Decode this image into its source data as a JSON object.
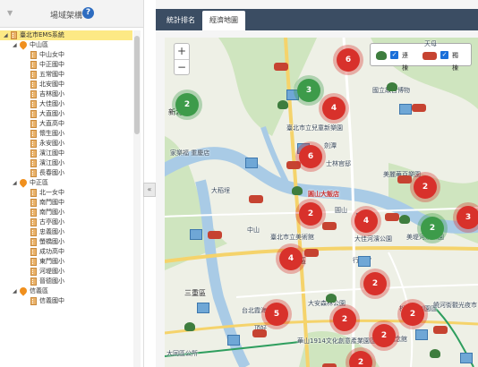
{
  "left": {
    "toggle_icon": "▼",
    "title": "場域架構",
    "help_icon": "?",
    "tree": [
      {
        "label": "臺北市EMS系統",
        "level": 0,
        "type": "root"
      },
      {
        "label": "中山區",
        "level": 1,
        "type": "district"
      },
      {
        "label": "中山女中",
        "level": 2,
        "type": "school"
      },
      {
        "label": "中正國中",
        "level": 2,
        "type": "school"
      },
      {
        "label": "五常國中",
        "level": 2,
        "type": "school"
      },
      {
        "label": "北安國中",
        "level": 2,
        "type": "school"
      },
      {
        "label": "吉林國小",
        "level": 2,
        "type": "school"
      },
      {
        "label": "大佳國小",
        "level": 2,
        "type": "school"
      },
      {
        "label": "大直國小",
        "level": 2,
        "type": "school"
      },
      {
        "label": "大直高中",
        "level": 2,
        "type": "school"
      },
      {
        "label": "懷生國小",
        "level": 2,
        "type": "school"
      },
      {
        "label": "永安國小",
        "level": 2,
        "type": "school"
      },
      {
        "label": "濱江國中",
        "level": 2,
        "type": "school"
      },
      {
        "label": "濱江國小",
        "level": 2,
        "type": "school"
      },
      {
        "label": "長春國小",
        "level": 2,
        "type": "school"
      },
      {
        "label": "中正區",
        "level": 1,
        "type": "district"
      },
      {
        "label": "北一女中",
        "level": 2,
        "type": "school"
      },
      {
        "label": "南門國中",
        "level": 2,
        "type": "school"
      },
      {
        "label": "南門國小",
        "level": 2,
        "type": "school"
      },
      {
        "label": "古亭國小",
        "level": 2,
        "type": "school"
      },
      {
        "label": "忠義國小",
        "level": 2,
        "type": "school"
      },
      {
        "label": "螢橋國小",
        "level": 2,
        "type": "school"
      },
      {
        "label": "成功高中",
        "level": 2,
        "type": "school"
      },
      {
        "label": "東門國小",
        "level": 2,
        "type": "school"
      },
      {
        "label": "河堤國小",
        "level": 2,
        "type": "school"
      },
      {
        "label": "晉德國小",
        "level": 2,
        "type": "school"
      },
      {
        "label": "信義區",
        "level": 1,
        "type": "district"
      },
      {
        "label": "信義國中",
        "level": 2,
        "type": "school"
      }
    ],
    "collapse_icon": "«"
  },
  "tabs": [
    {
      "label": "統計排名",
      "active": false
    },
    {
      "label": "經濟地圖",
      "active": true
    }
  ],
  "map": {
    "zoom_in": "+",
    "zoom_out": "−",
    "legend": [
      {
        "label": "連棟",
        "checked": true,
        "icon": "tree-icon"
      },
      {
        "label": "獨棟",
        "checked": true,
        "icon": "fire-truck-icon"
      }
    ],
    "clusters": [
      {
        "count": "6",
        "color": "red"
      },
      {
        "count": "2",
        "color": "green"
      },
      {
        "count": "3",
        "color": "green"
      },
      {
        "count": "4",
        "color": "red"
      },
      {
        "count": "6",
        "color": "red"
      },
      {
        "count": "2",
        "color": "red"
      },
      {
        "count": "4",
        "color": "red"
      },
      {
        "count": "2",
        "color": "green"
      },
      {
        "count": "3",
        "color": "red"
      },
      {
        "count": "2",
        "color": "red"
      },
      {
        "count": "4",
        "color": "red"
      },
      {
        "count": "2",
        "color": "red"
      },
      {
        "count": "5",
        "color": "red"
      },
      {
        "count": "2",
        "color": "red"
      },
      {
        "count": "2",
        "color": "red"
      },
      {
        "count": "2",
        "color": "red"
      },
      {
        "count": "2",
        "color": "red"
      }
    ],
    "places": [
      "新北市",
      "國立故宮博物",
      "臺北市立兒童新樂園",
      "士林官邸",
      "圓山大飯店",
      "家樂福 重慶店",
      "美麗華百樂園",
      "大稻埕",
      "臺北市立美術館",
      "大佳河濱公園",
      "美堤河濱公園",
      "大同區",
      "行天宮",
      "三重區",
      "台北霞海城隍廟",
      "大安森林公園",
      "松山文創園區",
      "華山1914文化創意產業園區",
      "國父紀念館",
      "大同區公所",
      "饒河街觀光夜市",
      "劍潭",
      "圓山",
      "中山",
      "頂好",
      "天母"
    ],
    "colors": {
      "red": "#d8312b",
      "green": "#3d9b4a",
      "water": "#a9cbe6",
      "park": "#cfe5bf"
    }
  }
}
